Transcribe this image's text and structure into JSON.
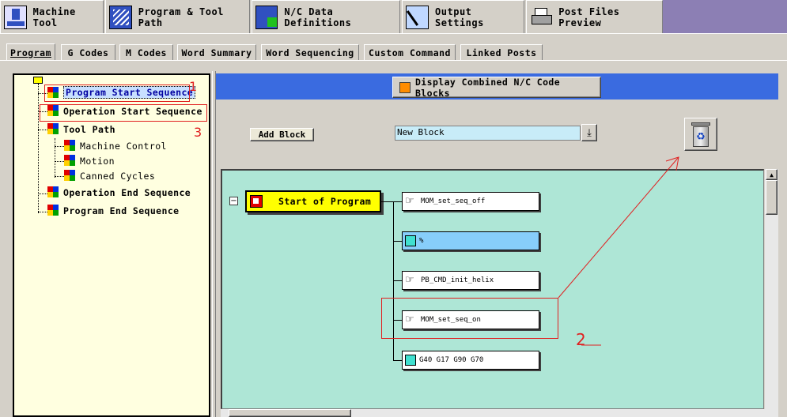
{
  "top_tabs": [
    {
      "label": "Machine Tool",
      "icon": "machine-tool-icon"
    },
    {
      "label": "Program & Tool Path",
      "icon": "program-tool-path-icon"
    },
    {
      "label": "N/C Data Definitions",
      "icon": "nc-data-icon"
    },
    {
      "label": "Output Settings",
      "icon": "output-settings-icon"
    },
    {
      "label": "Post Files Preview",
      "icon": "printer-icon"
    }
  ],
  "sub_tabs": [
    "Program",
    "G Codes",
    "M Codes",
    "Word Summary",
    "Word Sequencing",
    "Custom Command",
    "Linked Posts"
  ],
  "tree": [
    {
      "label": "Program Start Sequence",
      "selected": true
    },
    {
      "label": "Operation Start Sequence"
    },
    {
      "label": "Tool Path"
    },
    {
      "label": "Machine Control"
    },
    {
      "label": "Motion"
    },
    {
      "label": "Canned Cycles"
    },
    {
      "label": "Operation End Sequence"
    },
    {
      "label": "Program End Sequence"
    }
  ],
  "display_combined_label": "Display Combined N/C Code Blocks",
  "add_block_label": "Add Block",
  "new_block_value": "New Block",
  "trash_icon": "recycle-bin-icon",
  "start_of_program_label": "Start of Program",
  "blocks": [
    {
      "label": "MOM_set_seq_off",
      "type": "custom-command"
    },
    {
      "label": "%",
      "type": "nc-block",
      "highlighted": true
    },
    {
      "label": "PB_CMD_init_helix",
      "type": "custom-command"
    },
    {
      "label": "MOM_set_seq_on",
      "type": "custom-command"
    },
    {
      "label": "G40 G17 G90 G70",
      "type": "nc-block"
    }
  ],
  "annotations": {
    "one": "1",
    "two": "2",
    "three": "3"
  },
  "colors": {
    "tree_bg": "#ffffe0",
    "banner_blue": "#3a6be0",
    "canvas_teal": "#aee6d6",
    "start_yellow": "#ffff00",
    "annotation_red": "#e02020",
    "block_highlight": "#87cefa",
    "tab_strip_purple": "#8c7fb4"
  }
}
